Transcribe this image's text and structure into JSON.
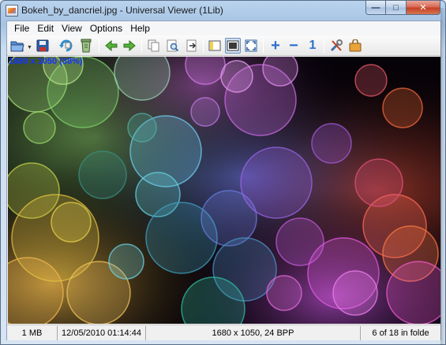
{
  "window": {
    "title": "Bokeh_by_dancriel.jpg - Universal Viewer (1Lib)",
    "minimize_glyph": "—",
    "maximize_glyph": "□",
    "close_glyph": "✕"
  },
  "menu": [
    {
      "label": "File"
    },
    {
      "label": "Edit"
    },
    {
      "label": "View"
    },
    {
      "label": "Options"
    },
    {
      "label": "Help"
    }
  ],
  "toolbar": {
    "icons": [
      "open-folder-icon",
      "save-icon",
      "rotate-icon",
      "recycle-bin-icon",
      "previous-arrow-icon",
      "next-arrow-icon",
      "copy-icon",
      "print-preview-icon",
      "export-icon",
      "thumbnails-panel-icon",
      "fit-window-icon",
      "fullscreen-icon",
      "zoom-in-icon",
      "zoom-out-icon",
      "actual-size-icon",
      "settings-tools-icon",
      "shopping-bag-icon"
    ],
    "zoom_in": "+",
    "zoom_out": "−",
    "actual_size": "1"
  },
  "image": {
    "info": "1680 x 1050 (38%)"
  },
  "status": {
    "size": "1 MB",
    "datetime": "12/05/2010 01:14:44",
    "dimensions": "1680 x 1050, 24 BPP",
    "position": "6 of 18 in folde"
  },
  "colors": {
    "accent_blue": "#2f6fcc",
    "info_text": "#1535ff",
    "close_red": "#c23e23"
  }
}
